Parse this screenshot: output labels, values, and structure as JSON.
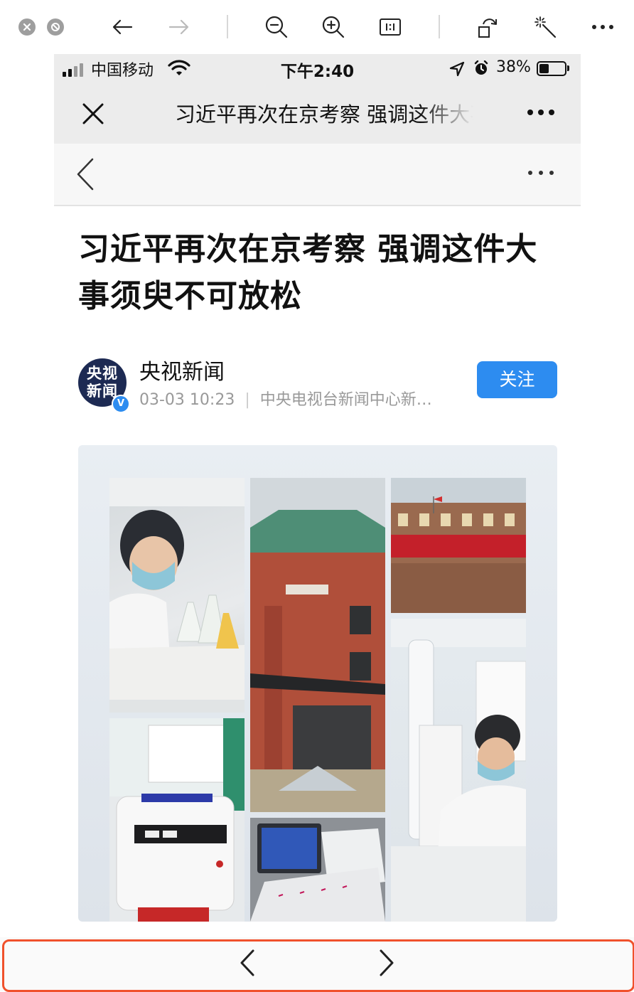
{
  "viewer_toolbar": {
    "icons": [
      "close-window-icon",
      "minimize-window-icon",
      "back-arrow-icon",
      "forward-arrow-icon",
      "zoom-out-icon",
      "zoom-in-icon",
      "actual-size-icon",
      "rotate-icon",
      "magic-wand-icon",
      "more-icon"
    ]
  },
  "status_bar": {
    "carrier": "中国移动",
    "time": "下午2:40",
    "battery": "38%",
    "battery_level": 0.38
  },
  "nav": {
    "title": "习近平再次在京考察 强调这件大事须臾不可放松"
  },
  "article": {
    "title": "习近平再次在京考察 强调这件大事须臾不可放松",
    "author": {
      "name": "央视新闻",
      "avatar_text": "央视新闻",
      "date": "03-03 10:23",
      "source": "中央电视台新闻中心新…",
      "follow_label": "关注"
    }
  },
  "colors": {
    "accent": "#2d8cf0",
    "highlight_border": "#f0512c"
  }
}
